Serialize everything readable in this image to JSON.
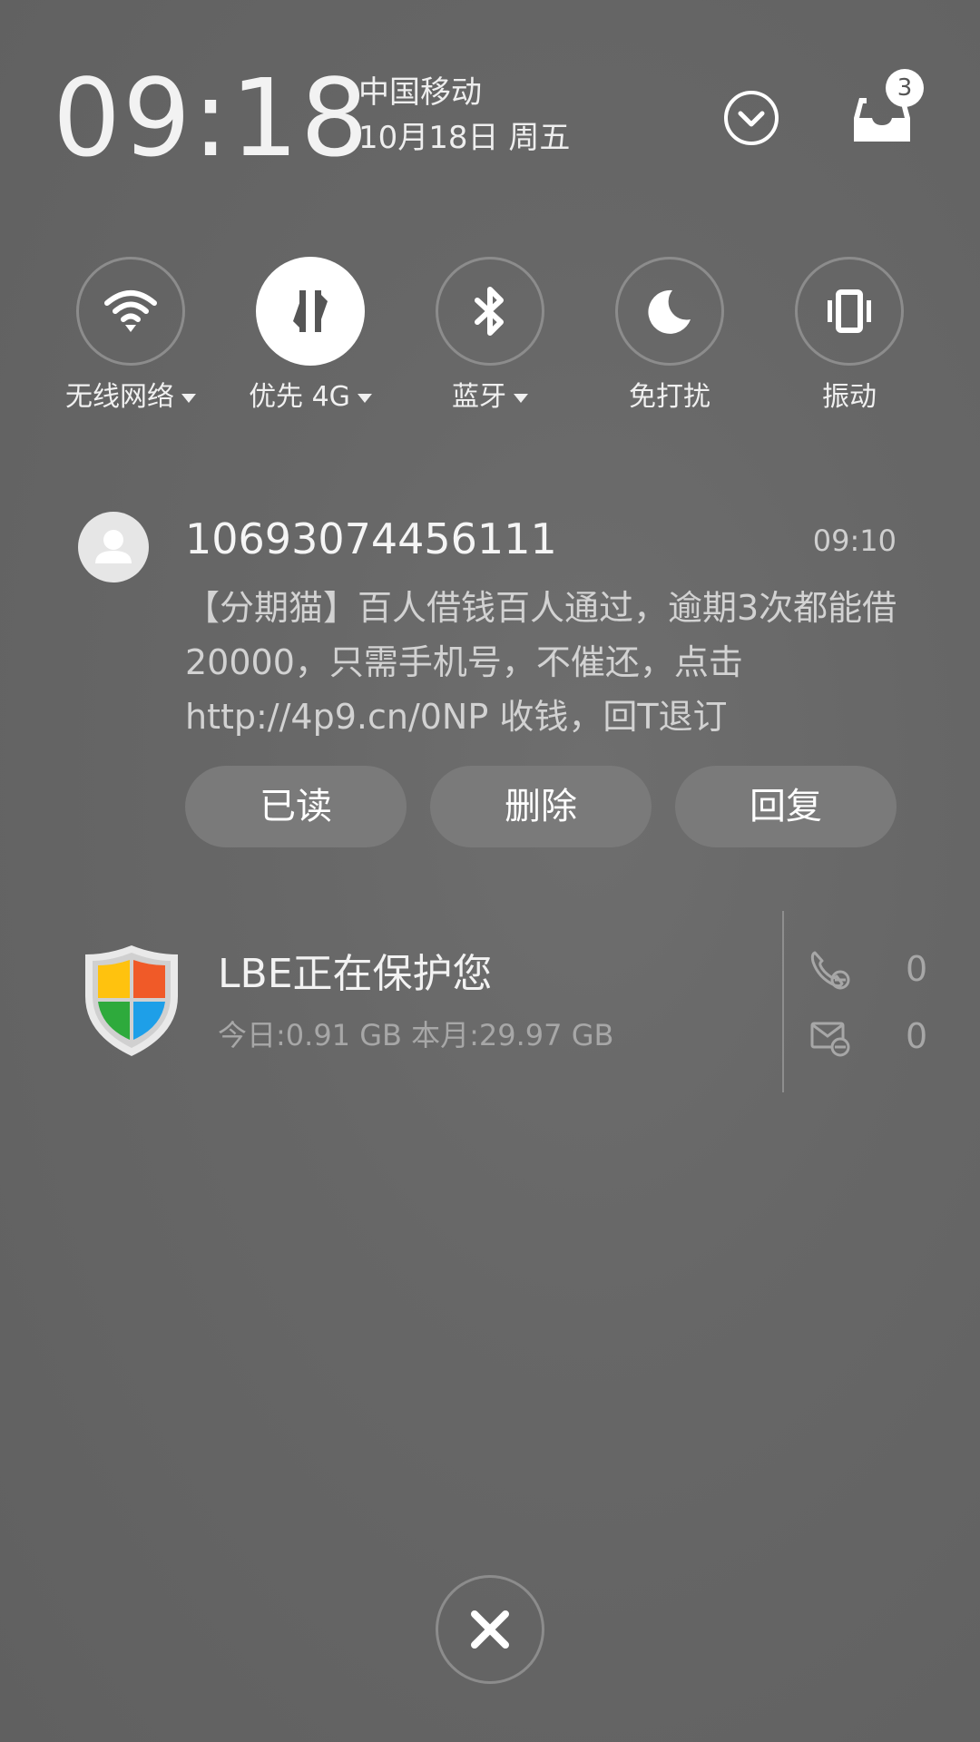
{
  "header": {
    "time": "09:18",
    "carrier": "中国移动",
    "date": "10月18日 周五",
    "expand_icon": "chevron-down-circle-icon",
    "inbox_icon": "inbox-tray-icon",
    "inbox_badge": "3"
  },
  "toggles": [
    {
      "label": "无线网络",
      "icon": "wifi-icon",
      "active": false,
      "has_caret": true
    },
    {
      "label": "优先 4G",
      "icon": "data-transfer-icon",
      "active": true,
      "has_caret": true
    },
    {
      "label": "蓝牙",
      "icon": "bluetooth-icon",
      "active": false,
      "has_caret": true
    },
    {
      "label": "免打扰",
      "icon": "moon-icon",
      "active": false,
      "has_caret": false
    },
    {
      "label": "振动",
      "icon": "vibrate-icon",
      "active": false,
      "has_caret": false
    }
  ],
  "sms": {
    "avatar_icon": "person-avatar-icon",
    "sender": "10693074456111",
    "time": "09:10",
    "body": "【分期猫】百人借钱百人通过，逾期3次都能借20000，只需手机号，不催还，点击http://4p9.cn/0NP 收钱，回T退订",
    "actions": {
      "read": "已读",
      "delete": "删除",
      "reply": "回复"
    }
  },
  "lbe": {
    "icon": "shield-icon",
    "title": "LBE正在保护您",
    "usage": "今日:0.91 GB 本月:29.97 GB",
    "calls_icon": "phone-blocked-icon",
    "calls_count": "0",
    "sms_icon": "message-blocked-icon",
    "sms_count": "0"
  },
  "close": {
    "icon": "close-icon"
  },
  "colors": {
    "background": "#646464",
    "button": "#7a7a7a",
    "shield_red": "#f05a28",
    "shield_green": "#2eaa3c",
    "shield_blue": "#1e9fe8",
    "shield_yellow": "#ffc20e"
  }
}
